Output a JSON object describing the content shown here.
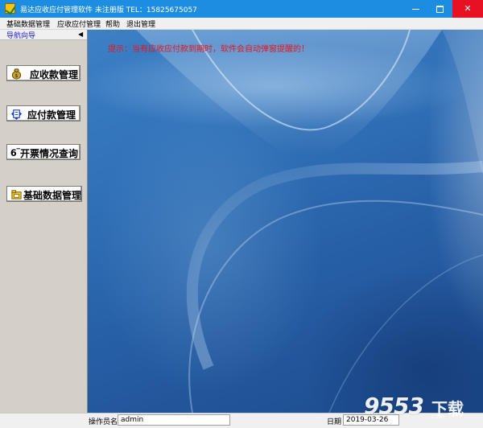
{
  "window": {
    "title": "易达应收应付管理软件 未注册版  TEL：15825675057",
    "controls": [
      "minimize",
      "maximize",
      "close"
    ]
  },
  "menu": {
    "items": [
      "基础数据管理",
      "应收应付管理",
      "帮助",
      "退出管理"
    ]
  },
  "sidebar": {
    "header": "导航向导",
    "buttons": [
      {
        "label": "应收款管理",
        "icon": "money-bag-icon"
      },
      {
        "label": "应付款管理",
        "icon": "pay-arrows-icon"
      },
      {
        "label": "开票情况查询",
        "icon": "invoice-icon"
      },
      {
        "label": "基础数据管理",
        "icon": "data-folder-icon"
      }
    ]
  },
  "main": {
    "notice": "提示：当有应收应付款到期时，软件会自动弹窗提醒的！"
  },
  "status": {
    "operator_label": "操作员名",
    "operator": "admin",
    "date_label": "日期",
    "date": "2019-03-26"
  },
  "watermark": {
    "site": "9553",
    "suffix": "下载",
    "domain": ".com"
  },
  "colors": {
    "titlebar": "#1c8de0",
    "close": "#e81123",
    "notice": "#e8141c",
    "nav_header": "#1b1bcf",
    "sidebar_bg": "#d4d0c8"
  }
}
